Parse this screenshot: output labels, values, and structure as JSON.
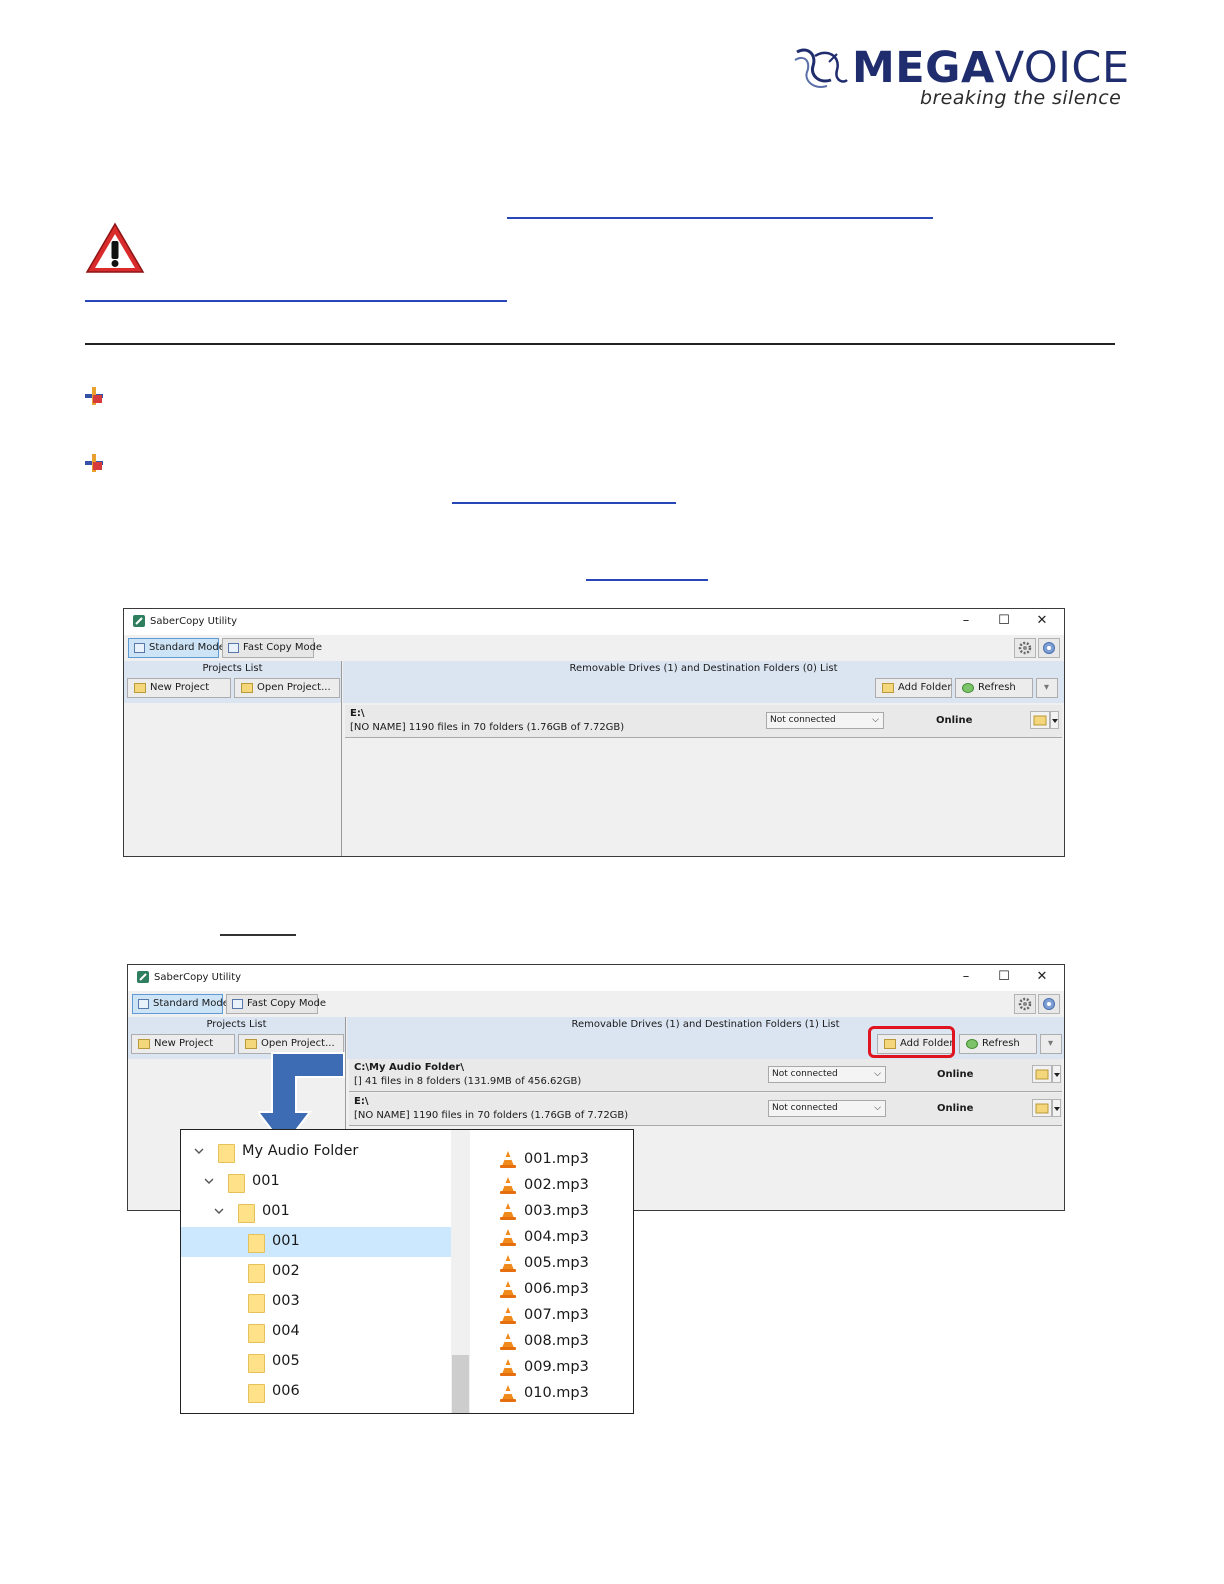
{
  "logo": {
    "brand_bold": "MEGA",
    "brand_regular": "VOICE",
    "tagline": "breaking the silence"
  },
  "windows": [
    {
      "title": "SaberCopy Utility",
      "modes": {
        "standard": "Standard Mode",
        "fast": "Fast Copy Mode"
      },
      "projects": {
        "header": "Projects List",
        "new": "New Project",
        "open": "Open Project..."
      },
      "drives": {
        "header": "Removable Drives (1) and Destination Folders (0) List",
        "add_folder": "Add Folder",
        "refresh": "Refresh"
      },
      "rows": [
        {
          "name": "E:\\",
          "info": "[NO NAME] 1190 files in 70 folders (1.76GB of 7.72GB)",
          "connection": "Not connected",
          "status": "Online"
        }
      ]
    },
    {
      "title": "SaberCopy Utility",
      "modes": {
        "standard": "Standard Mode",
        "fast": "Fast Copy Mode"
      },
      "projects": {
        "header": "Projects List",
        "new": "New Project",
        "open": "Open Project..."
      },
      "drives": {
        "header": "Removable Drives (1) and Destination Folders (1) List",
        "add_folder": "Add Folder",
        "refresh": "Refresh"
      },
      "rows": [
        {
          "name": "C:\\My Audio Folder\\",
          "info": "[] 41 files in 8 folders (131.9MB of 456.62GB)",
          "connection": "Not connected",
          "status": "Online"
        },
        {
          "name": "E:\\",
          "info": "[NO NAME] 1190 files in 70 folders (1.76GB of 7.72GB)",
          "connection": "Not connected",
          "status": "Online"
        }
      ]
    }
  ],
  "explorer": {
    "tree": [
      "My Audio Folder",
      "001",
      "001",
      "001",
      "002",
      "003",
      "004",
      "005",
      "006"
    ],
    "files": [
      "001.mp3",
      "002.mp3",
      "003.mp3",
      "004.mp3",
      "005.mp3",
      "006.mp3",
      "007.mp3",
      "008.mp3",
      "009.mp3",
      "010.mp3"
    ]
  },
  "colors": {
    "link_underline": "#2747b8",
    "logo_navy": "#1f2d6e",
    "highlight_red": "#e0141e",
    "arrow_blue": "#3d6cb4",
    "selection": "#cce8ff"
  }
}
